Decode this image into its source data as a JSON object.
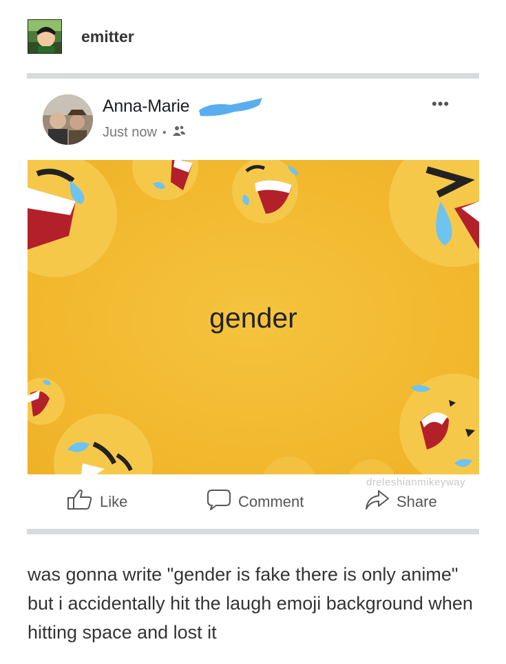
{
  "tumblr": {
    "blog_name": "emitter"
  },
  "post": {
    "author": "Anna-Marie",
    "time": "Just now",
    "separator": "•",
    "more_label": "•••",
    "background_text": "gender",
    "watermark": "dreleshianmikeyway"
  },
  "actions": {
    "like": "Like",
    "comment": "Comment",
    "share": "Share"
  },
  "caption": "was gonna write \"gender is fake there is only anime\" but i accidentally hit the laugh emoji background when hitting space and lost it",
  "colors": {
    "background_yellow": "#f2b92f",
    "redaction_blue": "#5aaef0",
    "divider_gray": "#d9dadc"
  }
}
